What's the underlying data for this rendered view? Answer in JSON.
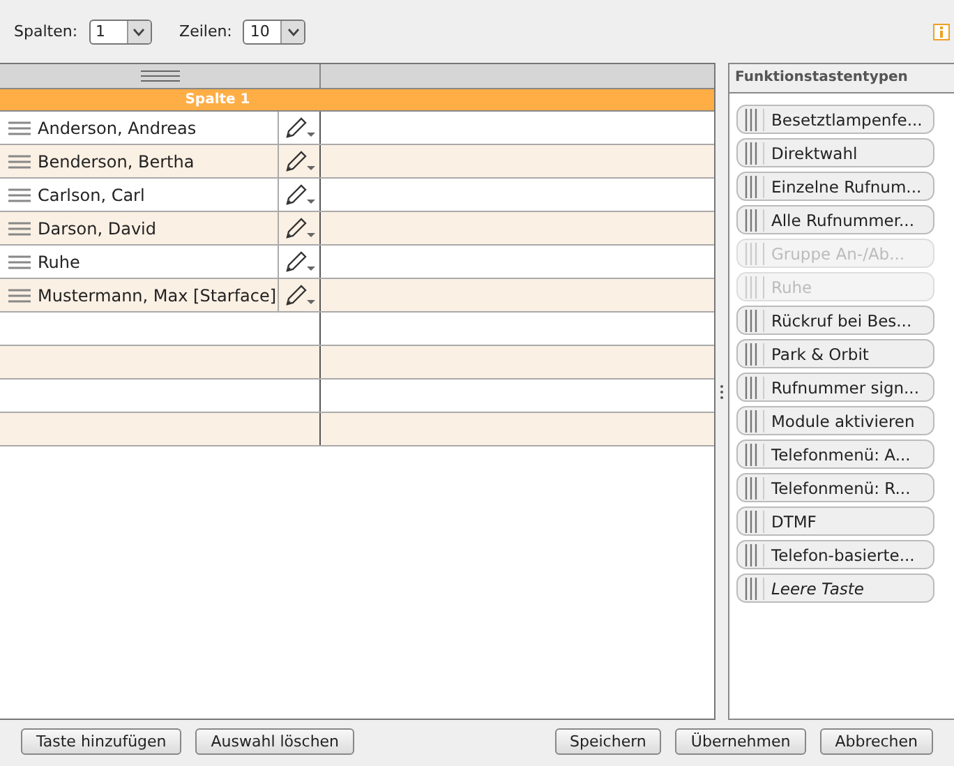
{
  "toolbar": {
    "columns_label": "Spalten:",
    "columns_value": "1",
    "rows_label": "Zeilen:",
    "rows_value": "10"
  },
  "grid": {
    "column_title": "Spalte 1",
    "rows": [
      {
        "kind": "entry",
        "label": "Anderson, Andreas"
      },
      {
        "kind": "entry",
        "label": "Benderson, Bertha"
      },
      {
        "kind": "entry",
        "label": "Carlson, Carl"
      },
      {
        "kind": "entry",
        "label": "Darson, David"
      },
      {
        "kind": "entry",
        "label": "Ruhe"
      },
      {
        "kind": "entry",
        "label": "Mustermann, Max [Starface]"
      },
      {
        "kind": "empty"
      },
      {
        "kind": "empty"
      },
      {
        "kind": "empty"
      },
      {
        "kind": "empty"
      }
    ]
  },
  "panel": {
    "title": "Funktionstastentypen",
    "items": [
      {
        "label": "Besetztlampenfe...",
        "kind": "function",
        "disabled": false
      },
      {
        "label": "Direktwahl",
        "kind": "function",
        "disabled": false
      },
      {
        "label": "Einzelne Rufnum...",
        "kind": "function",
        "disabled": false
      },
      {
        "label": "Alle Rufnummer...",
        "kind": "function",
        "disabled": false
      },
      {
        "label": "Gruppe An-/Ab...",
        "kind": "function",
        "disabled": true
      },
      {
        "label": "Ruhe",
        "kind": "function",
        "disabled": true
      },
      {
        "label": "Rückruf bei Bes...",
        "kind": "function",
        "disabled": false
      },
      {
        "label": "Park & Orbit",
        "kind": "function",
        "disabled": false
      },
      {
        "label": "Rufnummer sign...",
        "kind": "function",
        "disabled": false
      },
      {
        "label": "Module aktivieren",
        "kind": "function",
        "disabled": false
      },
      {
        "label": "Telefonmenü: A...",
        "kind": "function",
        "disabled": false
      },
      {
        "label": "Telefonmenü: R...",
        "kind": "function",
        "disabled": false
      },
      {
        "label": "DTMF",
        "kind": "function",
        "disabled": false
      },
      {
        "label": "Telefon-basierte...",
        "kind": "function",
        "disabled": false
      },
      {
        "label": "Leere Taste",
        "kind": "empty",
        "disabled": false
      }
    ]
  },
  "footer": {
    "left_buttons": [
      "Taste hinzufügen",
      "Auswahl löschen"
    ],
    "right_buttons": [
      "Speichern",
      "Übernehmen",
      "Abbrechen"
    ]
  }
}
